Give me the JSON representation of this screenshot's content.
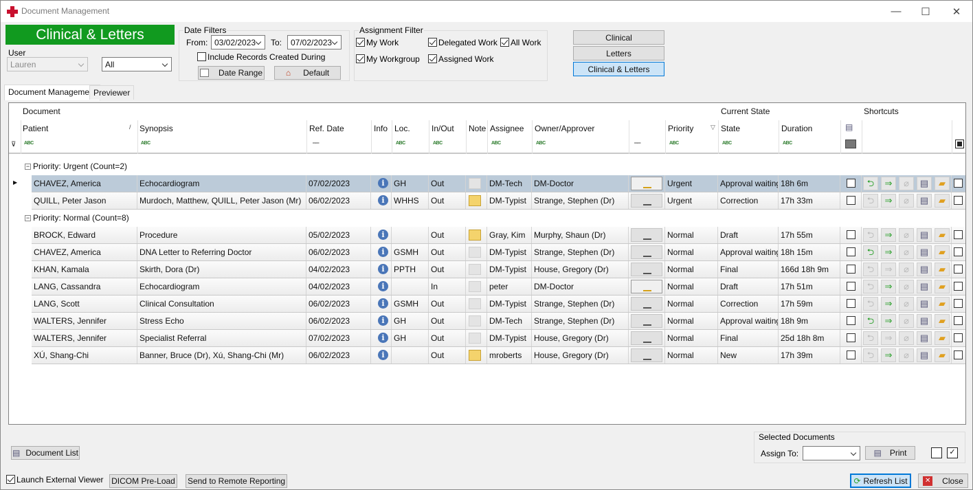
{
  "window": {
    "title": "Document Management",
    "banner": "Clinical & Letters"
  },
  "user": {
    "label": "User",
    "name": "Lauren",
    "scope": "All"
  },
  "date_filters": {
    "label": "Date Filters",
    "from_label": "From:",
    "from": "03/02/2023",
    "to_label": "To:",
    "to": "07/02/2023",
    "include_label": "Include Records Created During",
    "date_range": "Date Range",
    "default": "Default"
  },
  "assignment": {
    "label": "Assignment Filter",
    "my_work": "My Work",
    "delegated_work": "Delegated Work",
    "all_work": "All Work",
    "my_workgroup": "My Workgroup",
    "assigned_work": "Assigned Work"
  },
  "view": {
    "clinical": "Clinical",
    "letters": "Letters",
    "clinical_letters": "Clinical & Letters"
  },
  "tabs": {
    "doc_mgmt": "Document Management",
    "previewer": "Previewer"
  },
  "columns": {
    "document": "Document",
    "current_state": "Current State",
    "shortcuts": "Shortcuts",
    "patient": "Patient",
    "synopsis": "Synopsis",
    "ref_date": "Ref. Date",
    "info": "Info",
    "loc": "Loc.",
    "inout": "In/Out",
    "note": "Note",
    "assignee": "Assignee",
    "owner": "Owner/Approver",
    "priority": "Priority",
    "state": "State",
    "duration": "Duration"
  },
  "groups": [
    {
      "label": "Priority: Urgent (Count=2)"
    },
    {
      "label": "Priority: Normal (Count=8)"
    }
  ],
  "rows": [
    {
      "patient": "CHAVEZ, America",
      "synopsis": "Echocardiogram",
      "date": "07/02/2023",
      "loc": "GH",
      "io": "Out",
      "assignee": "DM-Tech",
      "owner": "DM-Doctor",
      "priority": "Urgent",
      "state": "Approval waiting",
      "duration": "18h 6m"
    },
    {
      "patient": "QUILL, Peter Jason",
      "synopsis": "Murdoch, Matthew, QUILL, Peter Jason (Mr)",
      "date": "06/02/2023",
      "loc": "WHHS",
      "io": "Out",
      "assignee": "DM-Typist",
      "owner": "Strange, Stephen (Dr)",
      "priority": "Urgent",
      "state": "Correction",
      "duration": "17h 33m"
    },
    {
      "patient": "BROCK, Edward",
      "synopsis": "Procedure",
      "date": "05/02/2023",
      "loc": "",
      "io": "Out",
      "assignee": "Gray, Kim",
      "owner": "Murphy, Shaun (Dr)",
      "priority": "Normal",
      "state": "Draft",
      "duration": "17h 55m"
    },
    {
      "patient": "CHAVEZ, America",
      "synopsis": "DNA Letter to Referring Doctor",
      "date": "06/02/2023",
      "loc": "GSMH",
      "io": "Out",
      "assignee": "DM-Typist",
      "owner": "Strange, Stephen (Dr)",
      "priority": "Normal",
      "state": "Approval waiting",
      "duration": "18h 15m"
    },
    {
      "patient": "KHAN, Kamala",
      "synopsis": "Skirth, Dora (Dr)",
      "date": "04/02/2023",
      "loc": "PPTH",
      "io": "Out",
      "assignee": "DM-Typist",
      "owner": "House, Gregory (Dr)",
      "priority": "Normal",
      "state": "Final",
      "duration": "166d 18h 9m"
    },
    {
      "patient": "LANG, Cassandra",
      "synopsis": "Echocardiogram",
      "date": "04/02/2023",
      "loc": "",
      "io": "In",
      "assignee": "peter",
      "owner": "DM-Doctor",
      "priority": "Normal",
      "state": "Draft",
      "duration": "17h 51m"
    },
    {
      "patient": "LANG, Scott",
      "synopsis": "Clinical Consultation",
      "date": "06/02/2023",
      "loc": "GSMH",
      "io": "Out",
      "assignee": "DM-Typist",
      "owner": "Strange, Stephen (Dr)",
      "priority": "Normal",
      "state": "Correction",
      "duration": "17h 59m"
    },
    {
      "patient": "WALTERS, Jennifer",
      "synopsis": "Stress Echo",
      "date": "06/02/2023",
      "loc": "GH",
      "io": "Out",
      "assignee": "DM-Tech",
      "owner": "Strange, Stephen (Dr)",
      "priority": "Normal",
      "state": "Approval waiting",
      "duration": "18h 9m"
    },
    {
      "patient": "WALTERS, Jennifer",
      "synopsis": "Specialist Referral",
      "date": "07/02/2023",
      "loc": "GH",
      "io": "Out",
      "assignee": "DM-Typist",
      "owner": "House, Gregory (Dr)",
      "priority": "Normal",
      "state": "Final",
      "duration": "25d 18h 8m"
    },
    {
      "patient": "XÚ, Shang-Chi",
      "synopsis": "Banner, Bruce (Dr), Xú, Shang-Chi (Mr)",
      "date": "06/02/2023",
      "loc": "",
      "io": "Out",
      "assignee": "mroberts",
      "owner": "House, Gregory (Dr)",
      "priority": "Normal",
      "state": "New",
      "duration": "17h 39m"
    }
  ],
  "footer": {
    "document_list": "Document List",
    "selected_documents": "Selected Documents",
    "assign_to": "Assign To:",
    "print": "Print",
    "launch_viewer": "Launch External Viewer",
    "dicom": "DICOM Pre-Load",
    "remote": "Send to Remote Reporting",
    "refresh": "Refresh List",
    "close": "Close"
  }
}
